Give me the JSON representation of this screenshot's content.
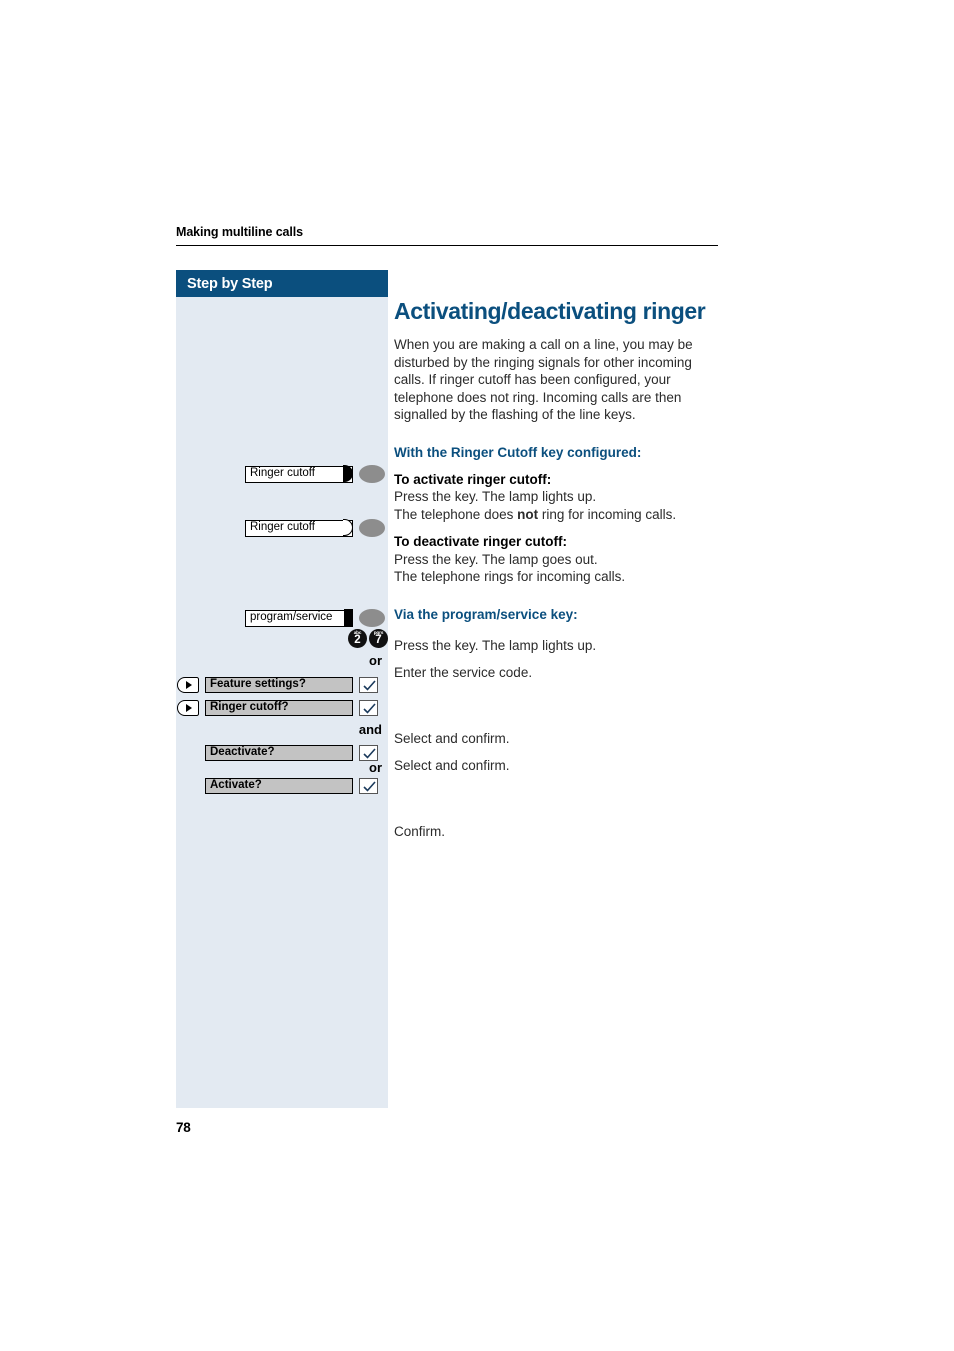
{
  "running_head": {
    "title": "Making multiline calls"
  },
  "sidebar": {
    "header": "Step by Step"
  },
  "folio": {
    "page_number": "78"
  },
  "colors": {
    "brand_blue": "#0b4f7e",
    "sidebar_bg": "#e3eaf2",
    "menu_row_bg": "#c3c3c3",
    "lamp_disc": "#8d8d8d"
  },
  "main": {
    "title": "Activating/deactivating ringer",
    "intro": "When you are making a call on a line, you may be disturbed by the ringing signals for other incoming calls. If ringer cutoff has been configured, your telephone does not ring. Incoming calls are then signalled by the flashing of the line keys.",
    "section_1": {
      "heading": "With the Ringer Cutoff key configured:",
      "activate_heading": "To activate ringer cutoff:",
      "activate_line_1": "Press the key. The lamp lights up.",
      "activate_line_2_pre": "The telephone does ",
      "activate_line_2_bold": "not",
      "activate_line_2_post": " ring for incoming calls.",
      "deactivate_heading": "To deactivate ringer cutoff:",
      "deactivate_line_1": "Press the key. The lamp goes out.",
      "deactivate_line_2": "The telephone rings for incoming calls."
    },
    "section_2": {
      "heading": "Via the program/service key:",
      "step_1": "Press the key. The lamp lights up.",
      "step_2": "Enter the service code.",
      "step_3": "Select and confirm.",
      "step_4": "Select and confirm.",
      "step_5": "Confirm."
    }
  },
  "keys": [
    {
      "label": "Ringer cutoff",
      "lamp_state": "on"
    },
    {
      "label": "Ringer cutoff",
      "lamp_state": "off"
    },
    {
      "label": "program/service",
      "lamp_state": "flag"
    }
  ],
  "service_code": {
    "digits": [
      {
        "letters": "abc",
        "digit": "2"
      },
      {
        "letters": "pqrs",
        "digit": "7"
      }
    ]
  },
  "menu_rows": [
    {
      "label": "Feature settings?",
      "has_nav": true,
      "confirm": "check"
    },
    {
      "label": "Ringer cutoff?",
      "has_nav": true,
      "confirm": "check"
    },
    {
      "label": "Deactivate?",
      "has_nav": false,
      "confirm": "check"
    },
    {
      "label": "Activate?",
      "has_nav": false,
      "confirm": "check"
    }
  ],
  "connectors": {
    "or_1": "or",
    "and_1": "and",
    "or_2": "or"
  }
}
